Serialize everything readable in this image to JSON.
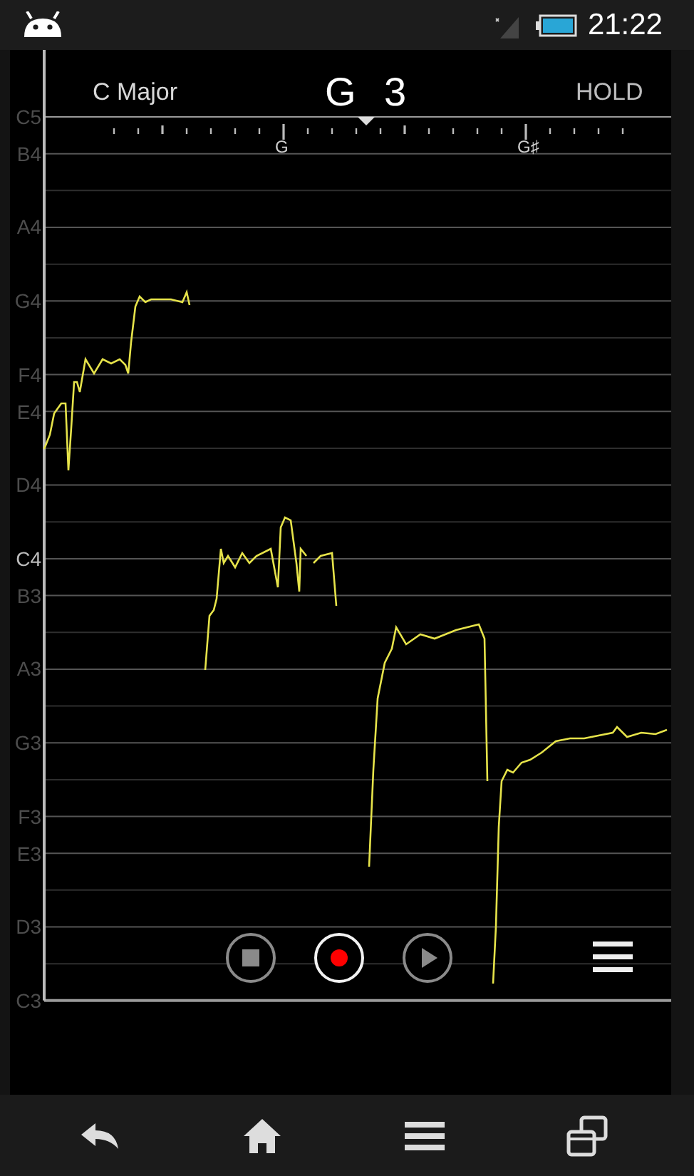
{
  "status_bar": {
    "time": "21:22"
  },
  "header": {
    "scale": "C Major",
    "note": "G 3",
    "hold": "HOLD"
  },
  "tuner": {
    "labels": [
      {
        "text": "G"
      },
      {
        "text": "G♯"
      }
    ]
  },
  "staff": {
    "labels": [
      {
        "text": "C5",
        "highlighted": false
      },
      {
        "text": "B4",
        "highlighted": false
      },
      {
        "text": "A4",
        "highlighted": false
      },
      {
        "text": "G4",
        "highlighted": false
      },
      {
        "text": "F4",
        "highlighted": false
      },
      {
        "text": "E4",
        "highlighted": false
      },
      {
        "text": "D4",
        "highlighted": false
      },
      {
        "text": "C4",
        "highlighted": true
      },
      {
        "text": "B3",
        "highlighted": false
      },
      {
        "text": "A3",
        "highlighted": false
      },
      {
        "text": "G3",
        "highlighted": false
      },
      {
        "text": "F3",
        "highlighted": false
      },
      {
        "text": "E3",
        "highlighted": false
      },
      {
        "text": "D3",
        "highlighted": false
      },
      {
        "text": "C3",
        "highlighted": false
      }
    ]
  },
  "transport": [
    {
      "kind": "stop",
      "active": false
    },
    {
      "kind": "record",
      "active": true
    },
    {
      "kind": "play",
      "active": false
    }
  ],
  "nav_bar": [
    {
      "kind": "back"
    },
    {
      "kind": "home"
    },
    {
      "kind": "menu"
    },
    {
      "kind": "recent"
    }
  ]
}
